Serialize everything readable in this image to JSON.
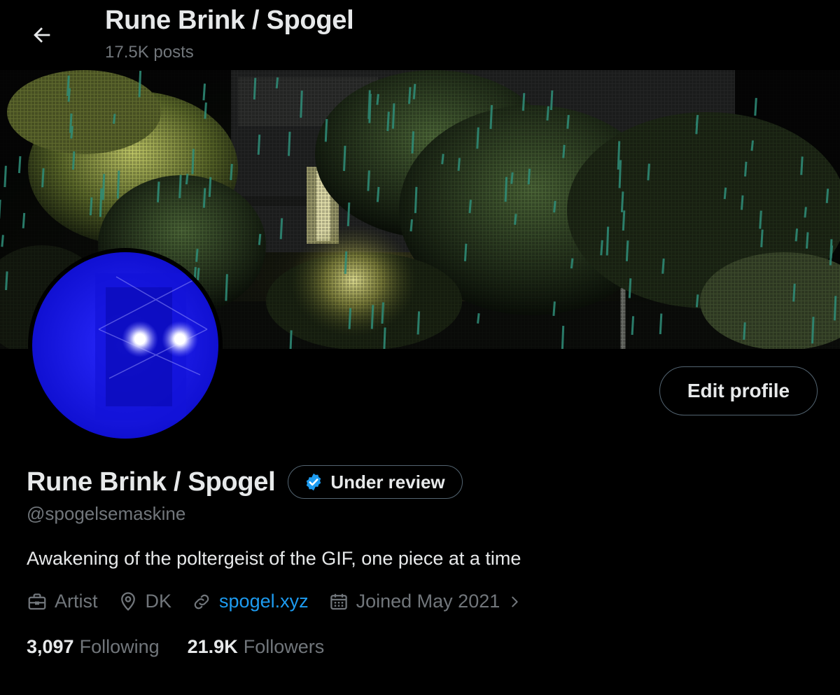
{
  "header": {
    "title": "Rune Brink / Spogel",
    "posts_count": "17.5K posts",
    "back_icon": "arrow-left-icon"
  },
  "profile": {
    "display_name": "Rune Brink / Spogel",
    "verification_badge": "Under review",
    "handle": "@spogelsemaskine",
    "bio": "Awakening of the poltergeist of the GIF, one piece at a time",
    "edit_button": "Edit profile",
    "meta": {
      "profession": "Artist",
      "location": "DK",
      "website": "spogel.xyz",
      "joined": "Joined May 2021"
    },
    "stats": {
      "following_count": "3,097",
      "following_label": "Following",
      "followers_count": "21.9K",
      "followers_label": "Followers"
    }
  },
  "colors": {
    "background": "#000000",
    "text_primary": "#e7e9ea",
    "text_secondary": "#71767b",
    "border": "#536471",
    "link": "#1d9bf0",
    "avatar_blue": "#1414e6",
    "rain": "#2f8f7a"
  }
}
